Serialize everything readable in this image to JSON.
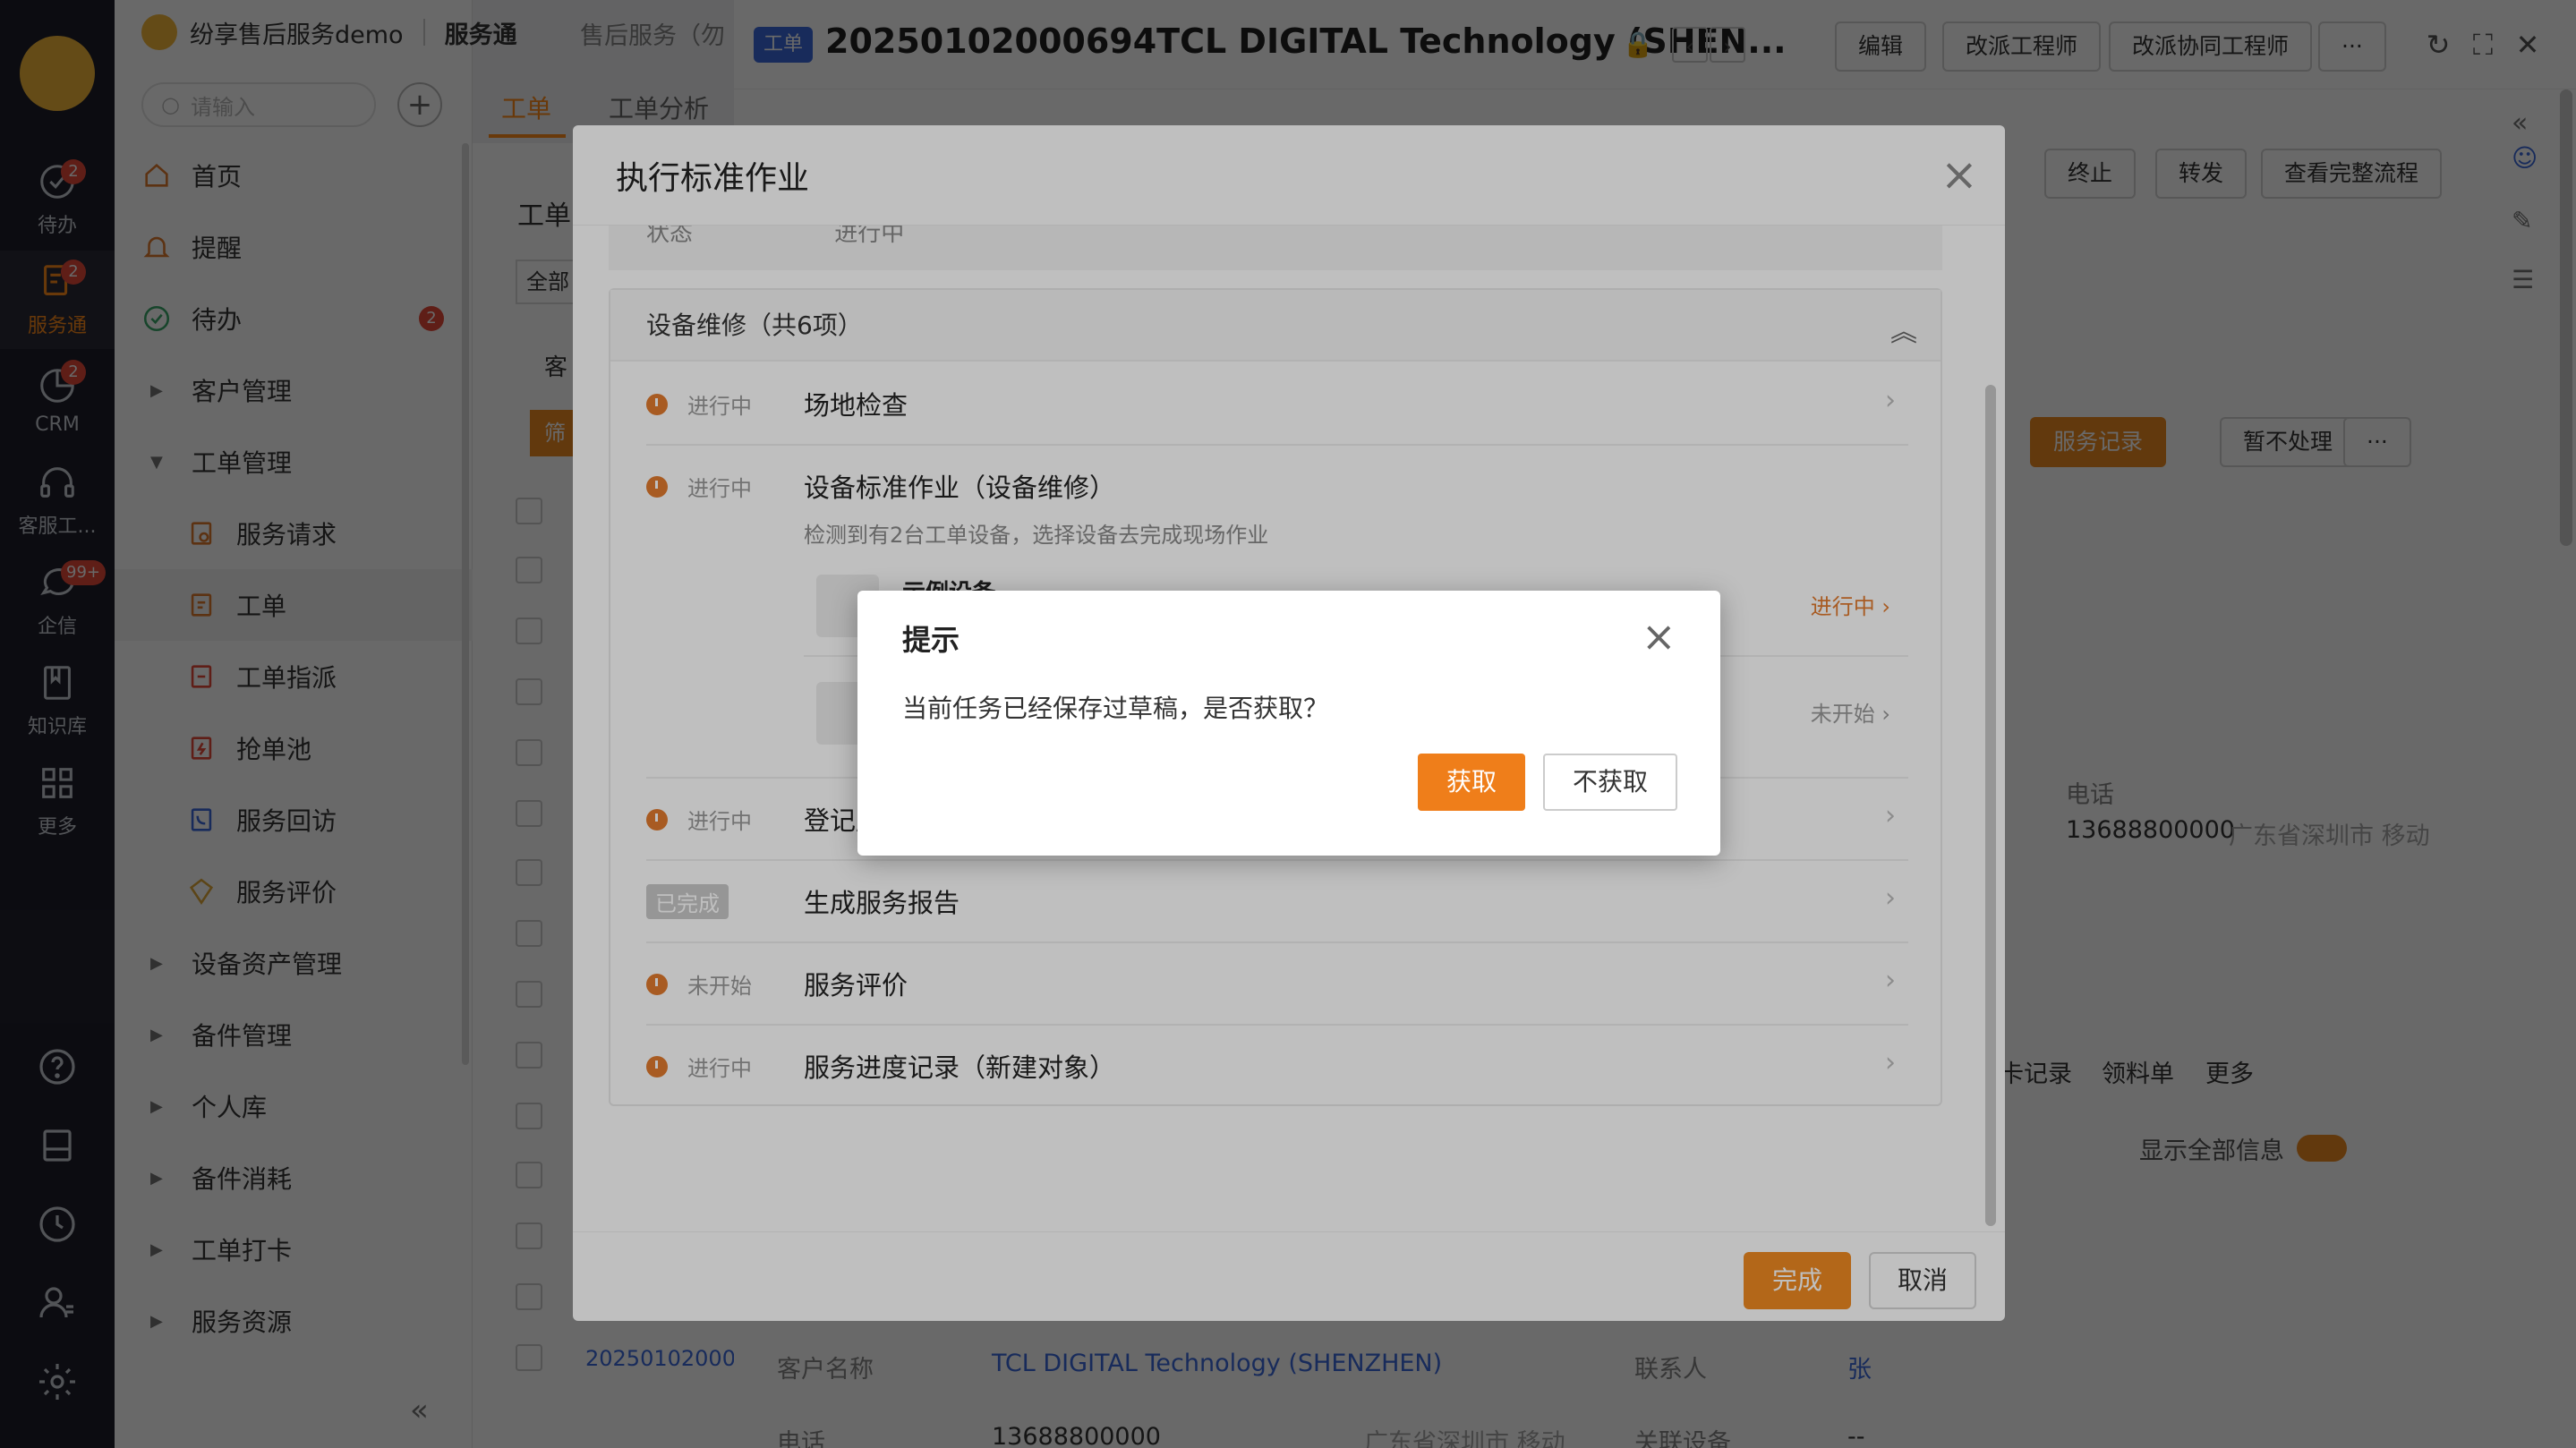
{
  "rail": {
    "items": [
      {
        "label": "待办",
        "badge": "2"
      },
      {
        "label": "服务通",
        "badge": "2"
      },
      {
        "label": "CRM",
        "badge": "2"
      },
      {
        "label": "客服工...",
        "badge": ""
      },
      {
        "label": "企信",
        "badge": "99+"
      },
      {
        "label": "知识库",
        "badge": ""
      },
      {
        "label": "更多",
        "badge": ""
      }
    ],
    "accent": "#ff8a1a"
  },
  "sidebar": {
    "brand": "纷享售后服务demo",
    "app": "服务通",
    "search_placeholder": "请输入",
    "menu": [
      {
        "label": "首页"
      },
      {
        "label": "提醒"
      },
      {
        "label": "待办",
        "badge": "2"
      },
      {
        "label": "客户管理"
      },
      {
        "label": "工单管理"
      },
      {
        "label": "服务请求"
      },
      {
        "label": "工单"
      },
      {
        "label": "工单指派"
      },
      {
        "label": "抢单池"
      },
      {
        "label": "服务回访"
      },
      {
        "label": "服务评价"
      },
      {
        "label": "设备资产管理"
      },
      {
        "label": "备件管理"
      },
      {
        "label": "个人库"
      },
      {
        "label": "备件消耗"
      },
      {
        "label": "工单打卡"
      },
      {
        "label": "服务资源"
      }
    ]
  },
  "background": {
    "breadcrumb": "售后服务（勿",
    "tabs": [
      "工单",
      "工单分析"
    ],
    "list_title": "工单",
    "filter_label": "全部",
    "list_header": "客",
    "filter_btn": "筛",
    "row_id": "202501020006"
  },
  "detail": {
    "tag": "工单",
    "title": "20250102000694TCL DIGITAL Technology (SHEN...",
    "buttons": [
      "编辑",
      "改派工程师",
      "改派协同工程师",
      "···"
    ],
    "sub_buttons": [
      "终止",
      "转发",
      "查看完整流程"
    ],
    "action_buttons": [
      "服务记录",
      "暂不处理",
      "···"
    ],
    "phone_label": "电话",
    "phone_value": "13688800000",
    "phone_location": "广东省深圳市 移动",
    "tab_labels": [
      "卡记录",
      "领料单",
      "更多"
    ],
    "show_all": "显示全部信息",
    "fields": {
      "customer_label": "客户名称",
      "customer_value": "TCL DIGITAL Technology (SHENZHEN)",
      "contact_label": "联系人",
      "contact_value": "张",
      "phone_label": "电话",
      "phone_value": "13688800000",
      "phone_location": "广东省深圳市 移动",
      "device_label": "关联设备",
      "device_value": "--"
    }
  },
  "std_modal": {
    "title": "执行标准作业",
    "status_label": "状态",
    "status_value": "进行中",
    "section_title": "设备维修（共6项）",
    "tasks": [
      {
        "status": "进行中",
        "name": "场地检查"
      },
      {
        "status": "进行中",
        "name": "设备标准作业（设备维修）",
        "desc": "检测到有2台工单设备，选择设备去完成现场作业",
        "devices": [
          {
            "name": "示例设备",
            "status": "进行中"
          },
          {
            "name": "",
            "status": "未开始"
          }
        ]
      },
      {
        "status": "进行中",
        "name": "登记服务"
      },
      {
        "status": "已完成",
        "name": "生成服务报告"
      },
      {
        "status": "未开始",
        "name": "服务评价"
      },
      {
        "status": "进行中",
        "name": "服务进度记录（新建对象）"
      }
    ],
    "complete": "完成",
    "cancel": "取消"
  },
  "dialog": {
    "title": "提示",
    "message": "当前任务已经保存过草稿，是否获取？",
    "confirm": "获取",
    "reject": "不获取"
  }
}
